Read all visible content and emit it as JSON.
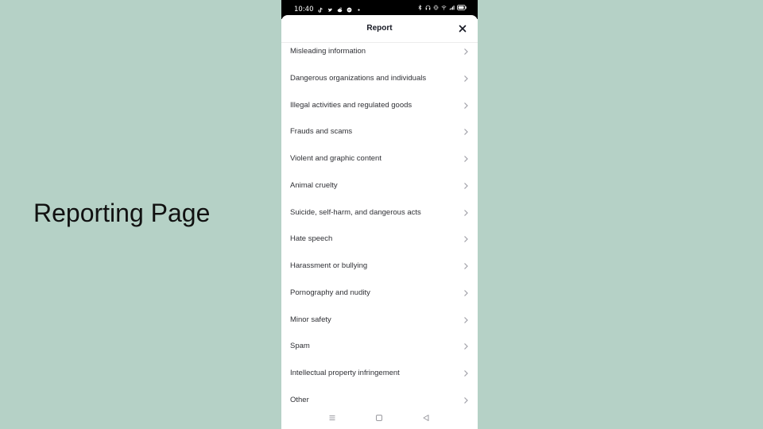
{
  "slide": {
    "title": "Reporting Page"
  },
  "status_bar": {
    "time": "10:40",
    "left_icons": [
      "tiktok-icon",
      "twitter-icon",
      "reddit-icon",
      "messenger-icon",
      "dot-icon"
    ],
    "right_icons": [
      "bluetooth-icon",
      "headphones-icon",
      "vibrate-icon",
      "wifi-icon",
      "signal-icon",
      "battery-icon"
    ]
  },
  "sheet": {
    "title": "Report",
    "close_icon": "close-icon",
    "items": [
      {
        "label": "Misleading information"
      },
      {
        "label": "Dangerous organizations and individuals"
      },
      {
        "label": "Illegal activities and regulated goods"
      },
      {
        "label": "Frauds and scams"
      },
      {
        "label": "Violent and graphic content"
      },
      {
        "label": "Animal cruelty"
      },
      {
        "label": "Suicide, self-harm, and dangerous acts"
      },
      {
        "label": "Hate speech"
      },
      {
        "label": "Harassment or bullying"
      },
      {
        "label": "Pornography and nudity"
      },
      {
        "label": "Minor safety"
      },
      {
        "label": "Spam"
      },
      {
        "label": "Intellectual property infringement"
      },
      {
        "label": "Other"
      }
    ]
  },
  "nav_bar": {
    "buttons": [
      "menu-icon",
      "home-icon",
      "back-icon"
    ]
  },
  "colors": {
    "background": "#b5d1c6",
    "text_primary": "#161823",
    "text_item": "#2f3035",
    "chevron": "#a0a0a8"
  }
}
